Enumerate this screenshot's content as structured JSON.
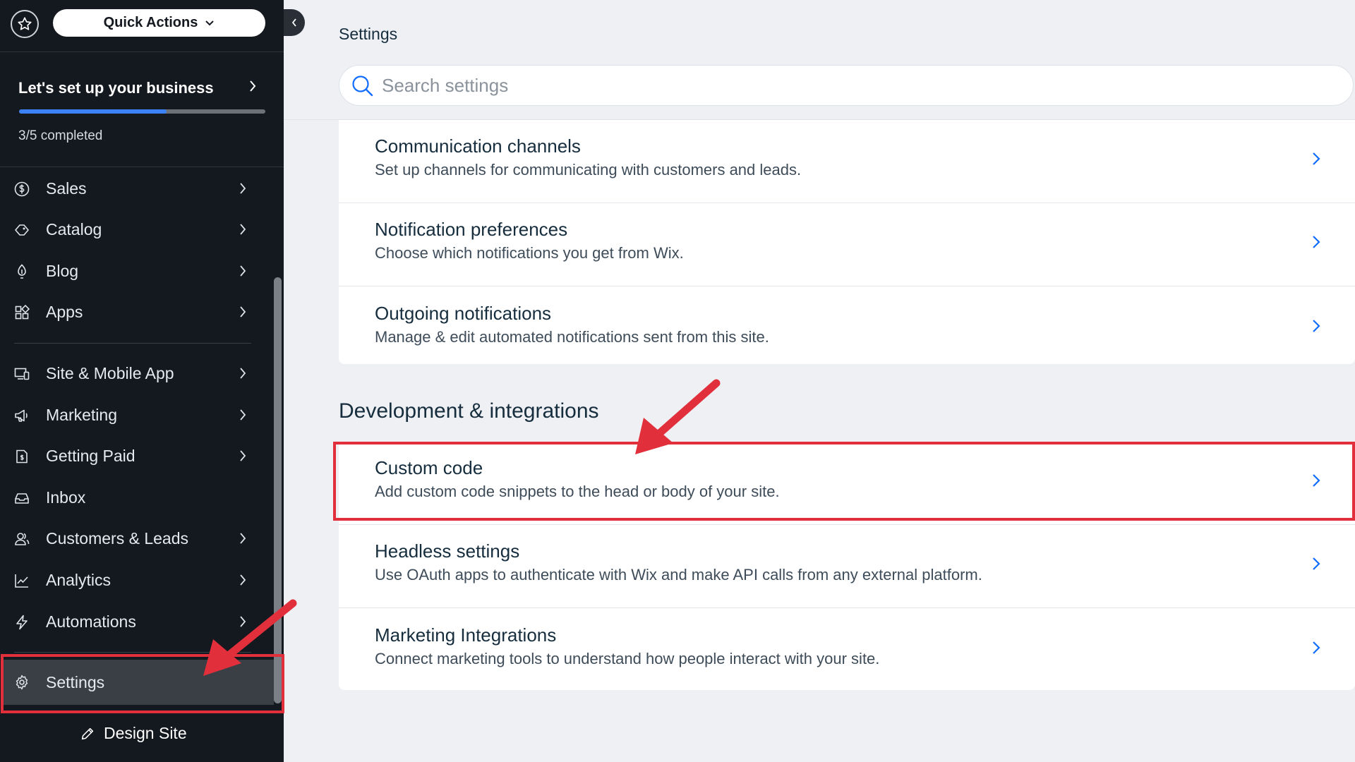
{
  "sidebar": {
    "quick_actions": "Quick Actions",
    "setup": {
      "title": "Let's set up your business",
      "status": "3/5 completed",
      "progress": 0.6
    },
    "items": [
      {
        "label": "Sales",
        "icon": "dollar-icon"
      },
      {
        "label": "Catalog",
        "icon": "tag-icon"
      },
      {
        "label": "Blog",
        "icon": "pen-nib-icon"
      },
      {
        "label": "Apps",
        "icon": "apps-icon"
      },
      {
        "label": "Site & Mobile App",
        "icon": "devices-icon"
      },
      {
        "label": "Marketing",
        "icon": "megaphone-icon"
      },
      {
        "label": "Getting Paid",
        "icon": "invoice-icon"
      },
      {
        "label": "Inbox",
        "icon": "inbox-icon"
      },
      {
        "label": "Customers & Leads",
        "icon": "people-icon"
      },
      {
        "label": "Analytics",
        "icon": "chart-icon"
      },
      {
        "label": "Automations",
        "icon": "lightning-icon"
      }
    ],
    "settings": "Settings",
    "design_site": "Design Site"
  },
  "main": {
    "title": "Settings",
    "search_placeholder": "Search settings",
    "group1": [
      {
        "title": "Communication channels",
        "desc": "Set up channels for communicating with customers and leads."
      },
      {
        "title": "Notification preferences",
        "desc": "Choose which notifications you get from Wix."
      },
      {
        "title": "Outgoing notifications",
        "desc": "Manage & edit automated notifications sent from this site."
      }
    ],
    "section_title": "Development & integrations",
    "group2": [
      {
        "title": "Custom code",
        "desc": "Add custom code snippets to the head or body of your site."
      },
      {
        "title": "Headless settings",
        "desc": "Use OAuth apps to authenticate with Wix and make API calls from any external platform."
      },
      {
        "title": "Marketing Integrations",
        "desc": "Connect marketing tools to understand how people interact with your site."
      }
    ]
  },
  "colors": {
    "sidebar_bg": "#14181f",
    "accent": "#3b82f6",
    "annotation": "#e1303b"
  }
}
